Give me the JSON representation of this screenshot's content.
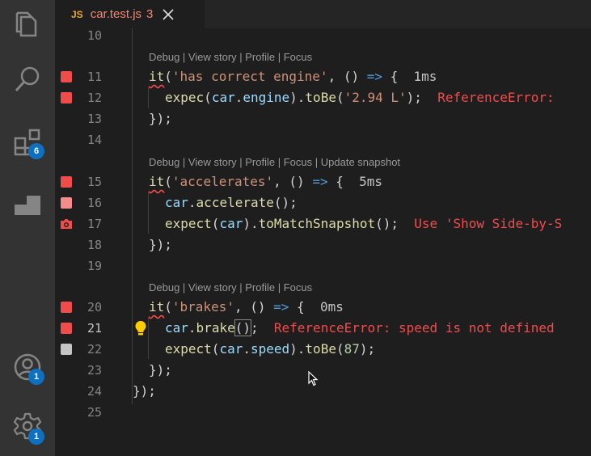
{
  "activity_bar": {
    "extensions_badge": "6",
    "accounts_badge": "1",
    "settings_badge": "1"
  },
  "tab": {
    "lang_icon": "JS",
    "name": "car.test.js",
    "problem_count": "3"
  },
  "editor": {
    "code_lens": {
      "debug": "Debug",
      "view_story": "View story",
      "profile": "Profile",
      "focus": "Focus",
      "update_snapshot": "Update snapshot",
      "separator": " | "
    },
    "lines": {
      "l10": "10",
      "l11": "11",
      "l12": "12",
      "l13": "13",
      "l14": "14",
      "l15": "15",
      "l16": "16",
      "l17": "17",
      "l18": "18",
      "l19": "19",
      "l20": "20",
      "l21": "21",
      "l22": "22",
      "l23": "23",
      "l24": "24",
      "l25": "25"
    },
    "tests": {
      "t1": {
        "it": "it",
        "open_paren": "(",
        "name": "'has correct engine'",
        "arrow_pre": ", () ",
        "arrow": "=>",
        "brace": " {",
        "time": "  1ms"
      },
      "t2": {
        "it": "it",
        "open_paren": "(",
        "name": "'accelerates'",
        "arrow_pre": ", () ",
        "arrow": "=>",
        "brace": " {",
        "time": "  5ms"
      },
      "t3": {
        "it": "it",
        "open_paren": "(",
        "name": "'brakes'",
        "arrow_pre": ", () ",
        "arrow": "=>",
        "brace": " {",
        "time": "  0ms"
      }
    },
    "line12": {
      "fn": "expec",
      "p1": "(",
      "obj": "car",
      "dot": ".",
      "prop": "engine",
      "p2": ").",
      "call": "toBe",
      "p3": "(",
      "str": "'2.94 L'",
      "p4": ");",
      "error": "  ReferenceError: "
    },
    "line16": {
      "obj": "car",
      "dot": ".",
      "call": "accelerate",
      "rest": "();"
    },
    "line17": {
      "fn": "expect",
      "p1": "(",
      "obj": "car",
      "p2": ").",
      "call": "toMatchSnapshot",
      "p3": "();",
      "error": "  Use 'Show Side-by-S"
    },
    "line21": {
      "obj": "car",
      "dot": ".",
      "call": "brake",
      "bracket": "()",
      "semi": ";",
      "error": "  ReferenceError: speed is not defined"
    },
    "line22": {
      "fn": "expect",
      "p1": "(",
      "obj": "car",
      "dot": ".",
      "prop": "speed",
      "p2": ").",
      "call": "toBe",
      "p3": "(",
      "num": "87",
      "p4": ");"
    },
    "close_block": "});",
    "colors": {
      "fail": "#f14c4c",
      "fail_light": "#f48c8c",
      "skipped": "#c5c5c5",
      "lightbulb": "#ffcc00"
    }
  }
}
